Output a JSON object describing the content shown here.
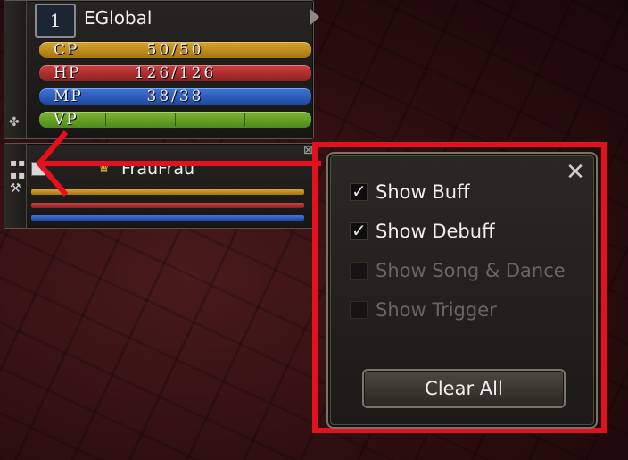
{
  "status_window": {
    "level": "1",
    "player_name": "EGlobal",
    "bars": {
      "cp": {
        "label": "CP",
        "value": "50/50",
        "fill": 1.0
      },
      "hp": {
        "label": "HP",
        "value": "126/126",
        "fill": 1.0
      },
      "mp": {
        "label": "MP",
        "value": "38/38",
        "fill": 1.0
      },
      "vp": {
        "label": "VP",
        "fill": 1.0
      }
    }
  },
  "party_window": {
    "member_name": "FrauFrau"
  },
  "buff_settings": {
    "options": [
      {
        "label": "Show Buff",
        "checked": true,
        "enabled": true
      },
      {
        "label": "Show Debuff",
        "checked": true,
        "enabled": true
      },
      {
        "label": "Show Song & Dance",
        "checked": false,
        "enabled": false
      },
      {
        "label": "Show Trigger",
        "checked": false,
        "enabled": false
      }
    ],
    "clear_all_label": "Clear All",
    "close_symbol": "✕"
  },
  "colors": {
    "annotation_red": "#e3101e",
    "cp": "#d6a32a",
    "hp": "#cc4040",
    "mp": "#3f75d6",
    "vp": "#7bb634"
  },
  "icons": {
    "settings": "gear-icon",
    "party_grid": "grid-icon",
    "party_tool": "tool-icon",
    "leader": "crown-icon",
    "close": "close-icon"
  }
}
